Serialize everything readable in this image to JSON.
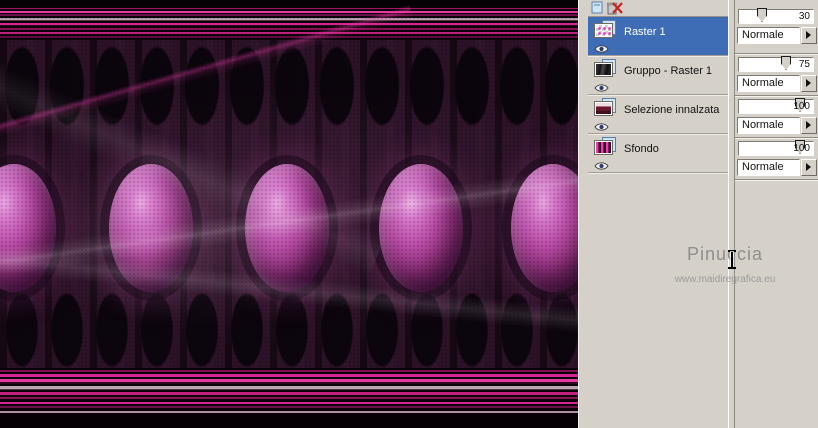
{
  "watermark": {
    "line1": "Pinuccia",
    "line2": "www.maidiregrafica.eu"
  },
  "layers_panel": {
    "layers": [
      {
        "name": "Raster 1",
        "opacity": "30",
        "blend_mode": "Normale",
        "selected": true
      },
      {
        "name": "Gruppo - Raster 1",
        "opacity": "75",
        "blend_mode": "Normale",
        "selected": false
      },
      {
        "name": "Selezione innalzata",
        "opacity": "100",
        "blend_mode": "Normale",
        "selected": false
      },
      {
        "name": "Sfondo",
        "opacity": "100",
        "blend_mode": "Normale",
        "selected": false
      }
    ]
  },
  "colors": {
    "selection_blue": "#3e6cb5",
    "panel_gray": "#d5d1c9",
    "accent_magenta": "#d3268e"
  }
}
